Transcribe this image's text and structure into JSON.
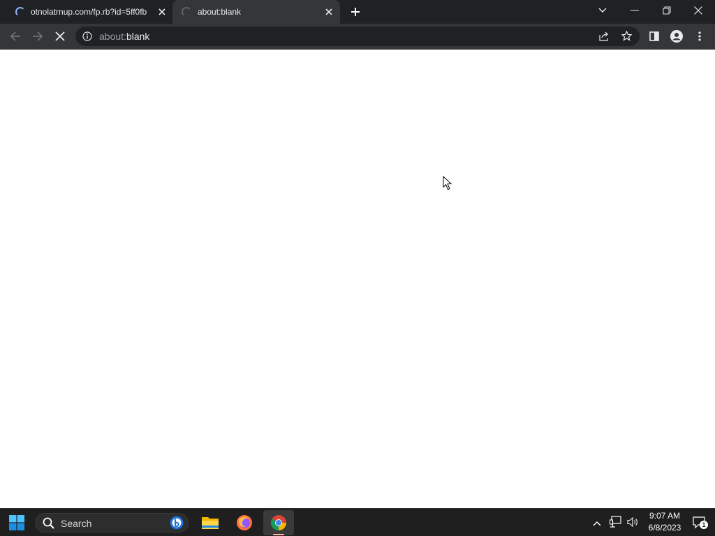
{
  "browser": {
    "tabs": [
      {
        "title": "otnolatrnup.com/fp.rb?id=5ff0fb",
        "loading": true,
        "active": false
      },
      {
        "title": "about:blank",
        "loading": true,
        "active": true
      }
    ],
    "new_tab_icon": "plus-icon",
    "window_controls": [
      "chevron-down-icon",
      "minimize-icon",
      "restore-icon",
      "close-icon"
    ]
  },
  "toolbar": {
    "omnibox": {
      "scheme": "about:",
      "host": "blank"
    },
    "icons": [
      "back-icon",
      "forward-icon",
      "stop-icon",
      "info-icon",
      "share-icon",
      "star-icon",
      "side-panel-icon",
      "profile-icon",
      "kebab-menu-icon"
    ]
  },
  "taskbar": {
    "search_label": "Search",
    "apps": [
      "windows-start-icon",
      "file-explorer-icon",
      "firefox-icon",
      "chrome-icon"
    ],
    "tray_icons": [
      "chevron-up-icon",
      "network-icon",
      "volume-icon",
      "notification-icon"
    ],
    "time": "9:07 AM",
    "date": "6/8/2023",
    "notification_count": "1"
  },
  "colors": {
    "tabstrip": "#202124",
    "toolbar": "#35363a",
    "spinner": "#8ab4f8",
    "taskbar": "#1f1f20"
  }
}
